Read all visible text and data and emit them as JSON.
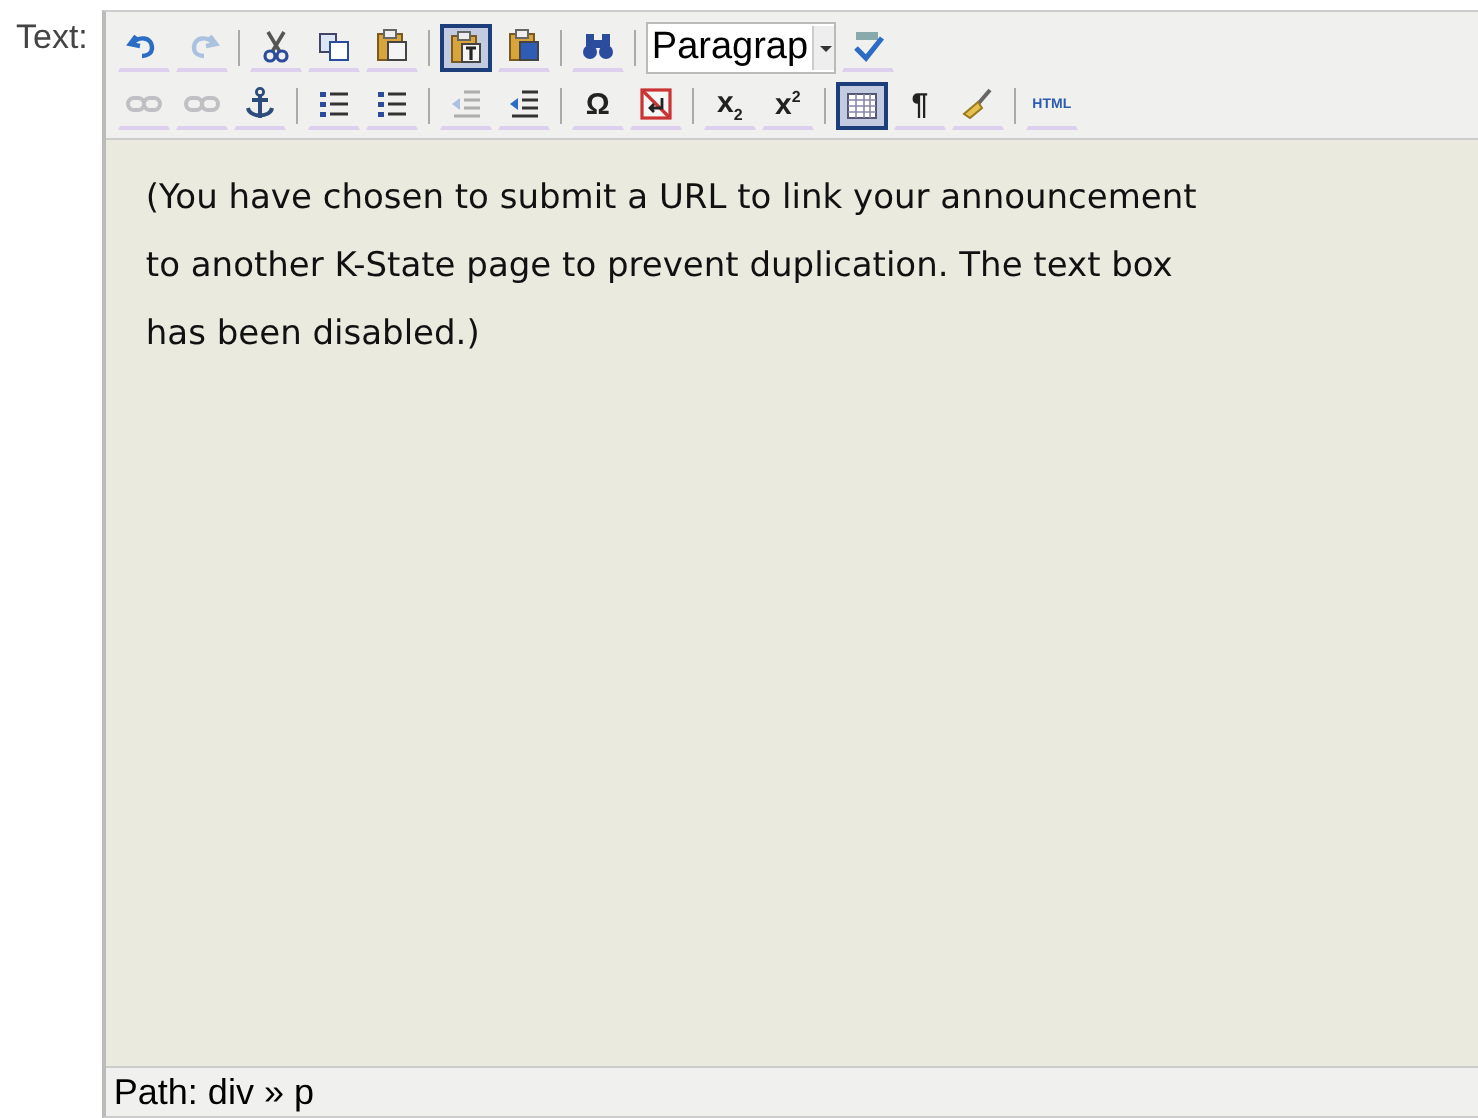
{
  "field_label": "Text:",
  "toolbar": {
    "rows": [
      [
        {
          "kind": "undo",
          "disabled": false,
          "selected": false
        },
        {
          "kind": "redo",
          "disabled": true,
          "selected": false
        },
        {
          "kind": "separator"
        },
        {
          "kind": "cut",
          "disabled": false,
          "selected": false
        },
        {
          "kind": "copy",
          "disabled": false,
          "selected": false
        },
        {
          "kind": "paste",
          "disabled": false,
          "selected": false
        },
        {
          "kind": "separator"
        },
        {
          "kind": "pastetext",
          "disabled": false,
          "selected": true
        },
        {
          "kind": "pasteword",
          "disabled": false,
          "selected": false
        },
        {
          "kind": "separator"
        },
        {
          "kind": "find",
          "disabled": false,
          "selected": false
        },
        {
          "kind": "separator"
        },
        {
          "kind": "select",
          "value": "Paragrap"
        },
        {
          "kind": "spellcheck",
          "disabled": false,
          "selected": false
        }
      ],
      [
        {
          "kind": "link",
          "disabled": true,
          "selected": false
        },
        {
          "kind": "unlink",
          "disabled": true,
          "selected": false
        },
        {
          "kind": "anchor",
          "disabled": false,
          "selected": false
        },
        {
          "kind": "separator"
        },
        {
          "kind": "bullist",
          "disabled": false,
          "selected": false
        },
        {
          "kind": "numlist",
          "disabled": false,
          "selected": false
        },
        {
          "kind": "separator"
        },
        {
          "kind": "outdent",
          "disabled": true,
          "selected": false
        },
        {
          "kind": "indent",
          "disabled": false,
          "selected": false
        },
        {
          "kind": "separator"
        },
        {
          "kind": "glyph",
          "label": "Ω",
          "disabled": false,
          "selected": false
        },
        {
          "kind": "nobreak",
          "disabled": false,
          "selected": false
        },
        {
          "kind": "separator"
        },
        {
          "kind": "glyph",
          "label": "x$_{2}$",
          "disabled": false,
          "selected": false
        },
        {
          "kind": "glyph",
          "label": "x$^{2}$",
          "disabled": false,
          "selected": false
        },
        {
          "kind": "separator"
        },
        {
          "kind": "visualaid",
          "disabled": false,
          "selected": true
        },
        {
          "kind": "glyph",
          "label": "¶",
          "disabled": false,
          "selected": false
        },
        {
          "kind": "cleanup",
          "disabled": false,
          "selected": false
        },
        {
          "kind": "separator"
        },
        {
          "kind": "label",
          "label": "HTML",
          "disabled": false,
          "selected": false
        }
      ]
    ]
  },
  "content": "(You have chosen to submit a URL to link your announcement to another K-State page to prevent duplication. The text box has been disabled.)",
  "status_bar": "Path: div » p"
}
